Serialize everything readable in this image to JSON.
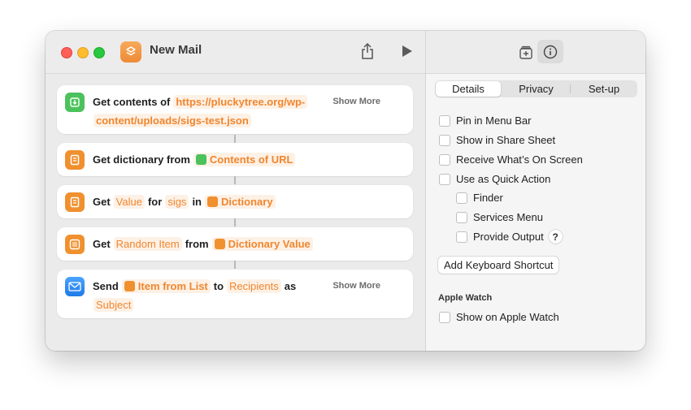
{
  "window": {
    "title": "New Mail",
    "toolbar": {
      "share_icon": "share-icon",
      "run_icon": "play-icon",
      "library_icon": "library-icon",
      "info_icon": "info-icon"
    }
  },
  "actions": [
    {
      "icon": "download-icon",
      "icon_color": "#4cc25c",
      "verb": "Get contents of",
      "url_line1": "https://pluckytree.org/wp-",
      "url_line2": "content/uploads/sigs-test.json",
      "show_more": "Show More"
    },
    {
      "icon": "dictionary-icon",
      "icon_color": "#f0902f",
      "verb": "Get dictionary from",
      "input": "Contents of URL"
    },
    {
      "icon": "dictionary-icon",
      "icon_color": "#f0902f",
      "verb": "Get",
      "param1": "Value",
      "word_for": "for",
      "key": "sigs",
      "word_in": "in",
      "input": "Dictionary"
    },
    {
      "icon": "list-icon",
      "icon_color": "#f0902f",
      "verb": "Get",
      "param1": "Random Item",
      "word_from": "from",
      "input": "Dictionary Value"
    },
    {
      "icon": "mail-icon",
      "icon_color": "#2f88f0",
      "verb": "Send",
      "input": "Item from List",
      "word_to": "to",
      "recipients": "Recipients",
      "word_as": "as",
      "subject": "Subject",
      "show_more": "Show More"
    }
  ],
  "details": {
    "tabs": [
      "Details",
      "Privacy",
      "Set-up"
    ],
    "active_tab": "Details",
    "options": {
      "pin_menu_bar": "Pin in Menu Bar",
      "share_sheet": "Show in Share Sheet",
      "receive_screen": "Receive What’s On Screen",
      "quick_action": "Use as Quick Action",
      "finder": "Finder",
      "services_menu": "Services Menu",
      "provide_output": "Provide Output",
      "help": "?"
    },
    "keyboard_shortcut_button": "Add Keyboard Shortcut",
    "apple_watch_heading": "Apple Watch",
    "show_on_watch": "Show on Apple Watch"
  },
  "colors": {
    "accent_orange": "#f1862e",
    "token_bg": "#fdf1e6",
    "traffic_red": "#fe5f57",
    "traffic_yellow": "#febc2e",
    "traffic_green": "#28c840"
  }
}
